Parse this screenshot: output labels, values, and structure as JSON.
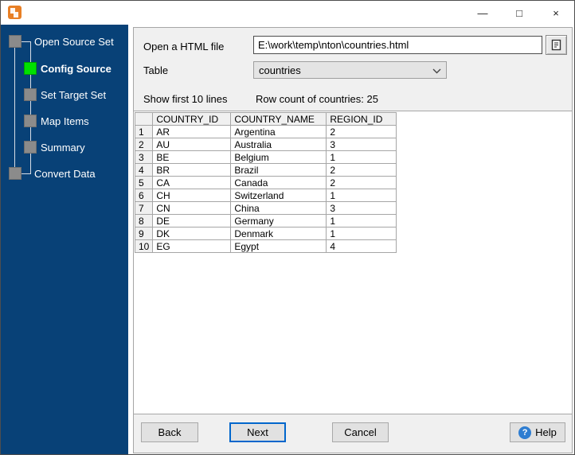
{
  "window": {
    "controls": {
      "minimize": "—",
      "maximize": "□",
      "close": "×"
    }
  },
  "colors": {
    "sidebar_bg": "#084177",
    "active_step": "#00e100",
    "inactive_step": "#8b8b8b",
    "next_accent": "#0066cc",
    "help_icon": "#2e7dd1",
    "app_icon": "#e87f25"
  },
  "sidebar": {
    "steps": [
      {
        "label": "Open Source Set",
        "level": 0,
        "state": "normal"
      },
      {
        "label": "Config Source",
        "level": 1,
        "state": "active"
      },
      {
        "label": "Set Target Set",
        "level": 1,
        "state": "normal"
      },
      {
        "label": "Map Items",
        "level": 1,
        "state": "normal"
      },
      {
        "label": "Summary",
        "level": 1,
        "state": "normal"
      },
      {
        "label": "Convert Data",
        "level": 0,
        "state": "normal"
      }
    ]
  },
  "form": {
    "file_label": "Open a HTML file",
    "file_value": "E:\\work\\temp\\nton\\countries.html",
    "table_label": "Table",
    "table_value": "countries",
    "show_lines_label": "Show first 10 lines",
    "row_count_label": "Row count of countries: 25"
  },
  "grid": {
    "num_header": "",
    "columns": [
      "COUNTRY_ID",
      "COUNTRY_NAME",
      "REGION_ID"
    ],
    "rows": [
      [
        "1",
        "AR",
        "Argentina",
        "2"
      ],
      [
        "2",
        "AU",
        "Australia",
        "3"
      ],
      [
        "3",
        "BE",
        "Belgium",
        "1"
      ],
      [
        "4",
        "BR",
        "Brazil",
        "2"
      ],
      [
        "5",
        "CA",
        "Canada",
        "2"
      ],
      [
        "6",
        "CH",
        "Switzerland",
        "1"
      ],
      [
        "7",
        "CN",
        "China",
        "3"
      ],
      [
        "8",
        "DE",
        "Germany",
        "1"
      ],
      [
        "9",
        "DK",
        "Denmark",
        "1"
      ],
      [
        "10",
        "EG",
        "Egypt",
        "4"
      ]
    ]
  },
  "footer": {
    "back": "Back",
    "next": "Next",
    "cancel": "Cancel",
    "help": "Help",
    "help_icon_glyph": "?"
  }
}
